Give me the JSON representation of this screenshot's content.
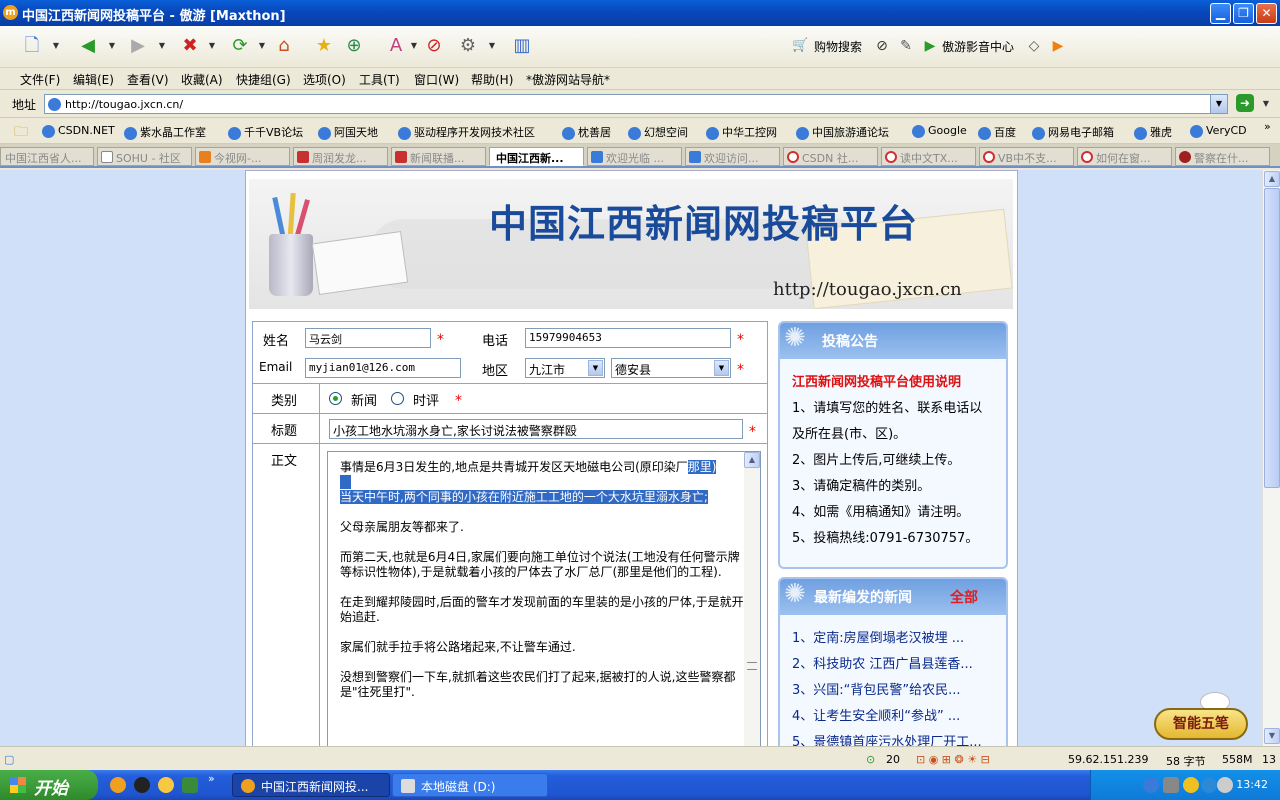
{
  "window": {
    "title": "中国江西新闻网投稿平台 - 傲游 [Maxthon]",
    "min": "▁",
    "max": "❐",
    "close": "✕"
  },
  "toolbar": {
    "shopping_search": "购物搜索",
    "media_center": "傲游影音中心"
  },
  "menu": [
    "文件(F)",
    "编辑(E)",
    "查看(V)",
    "收藏(A)",
    "快捷组(G)",
    "选项(O)",
    "工具(T)",
    "窗口(W)",
    "帮助(H)",
    "*傲游网站导航*"
  ],
  "address": {
    "label": "地址",
    "url": "http://tougao.jxcn.cn/"
  },
  "favorites": [
    "CSDN.NET",
    "紫水晶工作室",
    "千千VB论坛",
    "阿国天地",
    "驱动程序开发网技术社区",
    "枕善居",
    "幻想空间",
    "中华工控网",
    "中国旅游通论坛",
    "Google",
    "百度",
    "网易电子邮箱",
    "雅虎",
    "VeryCD"
  ],
  "tabs": [
    "中国江西省人...",
    "SOHU - 社区",
    "今视网-...",
    "周润发龙...",
    "新闻联播...",
    "中国江西新...",
    "欢迎光临 ...",
    "欢迎访问...",
    "CSDN 社...",
    "读中文TX...",
    "VB中不支...",
    "如何在窗...",
    "警察在什..."
  ],
  "active_tab": 5,
  "banner": {
    "title": "中国江西新闻网投稿平台",
    "url": "http://tougao.jxcn.cn"
  },
  "form": {
    "name_label": "姓名",
    "name_value": "马云剑",
    "phone_label": "电话",
    "phone_value": "15979904653",
    "email_label": "Email",
    "email_value": "myjian01@126.com",
    "region_label": "地区",
    "city": "九江市",
    "county": "德安县",
    "category_label": "类别",
    "cat_news": "新闻",
    "cat_comment": "时评",
    "title_label": "标题",
    "title_value": "小孩工地水坑溺水身亡,家长讨说法被警察群殴",
    "body_label": "正文",
    "required_mark": "*",
    "body": {
      "p1a": "事情是6月3日发生的,地点是共青城开发区天地磁电公司(原印染厂",
      "p1b": "那里)",
      "p2": "当天中午时,两个同事的小孩在附近施工工地的一个大水坑里溺水身亡;",
      "p3": "父母亲属朋友等都来了.",
      "p4": "而第二天,也就是6月4日,家属们要向施工单位讨个说法(工地没有任何警示牌等标识性物体),于是就载着小孩的尸体去了水厂总厂(那里是他们的工程).",
      "p5": "在走到耀邦陵园时,后面的警车才发现前面的车里装的是小孩的尸体,于是就开始追赶.",
      "p6": "家属们就手拉手将公路堵起来,不让警车通过.",
      "p7": "没想到警察们一下车,就抓着这些农民们打了起来,据被打的人说,这些警察都是\"往死里打\"."
    }
  },
  "notice": {
    "header": "投稿公告",
    "subtitle": "江西新闻网投稿平台使用说明",
    "lines": [
      "1、请填写您的姓名、联系电话以",
      "及所在县(市、区)。",
      "2、图片上传后,可继续上传。",
      "3、请确定稿件的类别。",
      "4、如需《用稿通知》请注明。",
      "5、投稿热线:0791-6730757。"
    ]
  },
  "latest": {
    "header": "最新编发的新闻",
    "all": "全部",
    "items": [
      "1、定南:房屋倒塌老汉被埋 ...",
      "2、科技助农 江西广昌县莲香...",
      "3、兴国:“背包民警”给农民...",
      "4、让考生安全顺利“参战” ...",
      "5、景德镇首座污水处理厂开工..."
    ]
  },
  "logo_text": "智能五笔",
  "status": {
    "count": "20",
    "ip": "59.62.151.239",
    "bytes": "58 字节",
    "mem": "558M",
    "num": "13"
  },
  "taskbar": {
    "start": "开始",
    "task1": "中国江西新闻网投...",
    "task2": "本地磁盘 (D:)",
    "clock": "13:42",
    "ime": "陳"
  },
  "colors": {
    "accent": "#0a5fd8",
    "required": "#ee0000",
    "notice_title": "#dd1111",
    "news_link": "#0a2a8a"
  }
}
